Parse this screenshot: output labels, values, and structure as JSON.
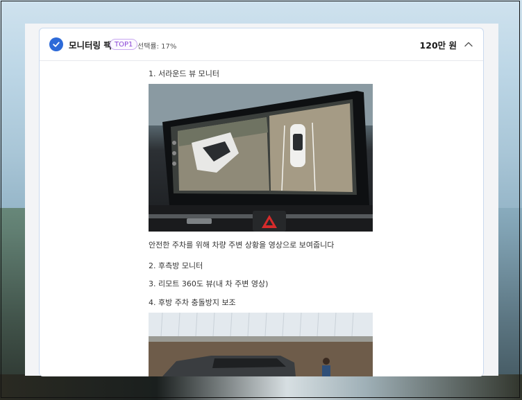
{
  "option": {
    "title": "모니터링 팩",
    "badge": "TOP1",
    "selection_rate": "선택률: 17%",
    "price": "120만 원"
  },
  "details": {
    "item1": "1. 서라운드 뷰 모니터",
    "item1_desc": "안전한 주차를 위해 차량 주변 상황을 영상으로 보여줍니다",
    "item2": "2. 후측방 모니터",
    "item3": "3. 리모트 360도 뷰(내 차 주변 영상)",
    "item4": "4. 후방 주차 충돌방지 보조"
  },
  "icons": {
    "check": "check-circle-icon",
    "collapse": "chevron-up-icon",
    "hazard": "hazard-triangle-icon"
  },
  "colors": {
    "accent": "#2d6ad8",
    "badge": "#8a45d6"
  }
}
